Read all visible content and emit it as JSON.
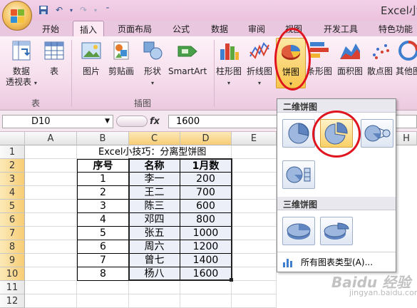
{
  "app_title": "Excel小",
  "tabs": [
    "开始",
    "插入",
    "页面布局",
    "公式",
    "数据",
    "审阅",
    "视图",
    "开发工具",
    "特色功能"
  ],
  "active_tab": "插入",
  "ribbon": {
    "groups": {
      "table": "表",
      "illustrations": "插图"
    },
    "buttons": {
      "pivot": [
        "数据",
        "透视表"
      ],
      "table": "表",
      "picture": "图片",
      "clipart": "剪贴画",
      "shapes": "形状",
      "smartart": "SmartArt",
      "column": "柱形图",
      "line": "折线图",
      "pie": "饼图",
      "bar": "条形图",
      "area": "面积图",
      "scatter": "散点图",
      "other": "其他图"
    }
  },
  "formula_bar": {
    "name_box": "D10",
    "fx": "fx",
    "value": "1600"
  },
  "columns": [
    "A",
    "B",
    "C",
    "D",
    "E",
    "H"
  ],
  "rows": [
    "1",
    "2",
    "3",
    "4",
    "5",
    "6",
    "7",
    "8",
    "9",
    "10",
    "11",
    "12"
  ],
  "sheet": {
    "title": "Excel小技巧：分离型饼图",
    "headers": [
      "序号",
      "名称",
      "1月数"
    ],
    "data": [
      [
        "1",
        "李一",
        "200"
      ],
      [
        "2",
        "王二",
        "700"
      ],
      [
        "3",
        "陈三",
        "600"
      ],
      [
        "4",
        "邓四",
        "800"
      ],
      [
        "5",
        "张五",
        "1000"
      ],
      [
        "6",
        "周六",
        "1200"
      ],
      [
        "7",
        "曾七",
        "1400"
      ],
      [
        "8",
        "杨八",
        "1600"
      ]
    ]
  },
  "pie_menu": {
    "section_2d": "二维饼图",
    "section_3d": "三维饼图",
    "all_types": "所有图表类型(A)..."
  },
  "watermark": {
    "brand": "Baidu 经验",
    "url": "jingyan.baidu.com"
  },
  "colors": {
    "highlight_circle": "#e0141e",
    "ribbon_bg": "#f5dcec",
    "selected_header": "#f7cd75"
  }
}
